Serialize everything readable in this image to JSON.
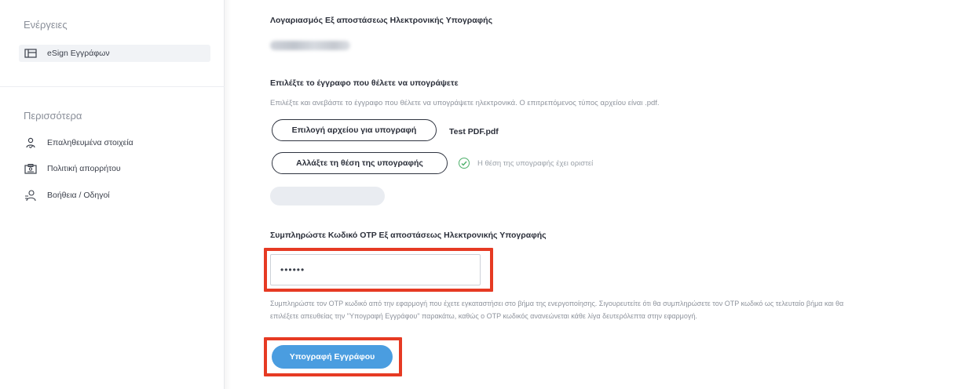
{
  "sidebar": {
    "actions_title": "Ενέργειες",
    "actions_items": [
      {
        "label": "eSign Εγγράφων",
        "icon": "document-grid-icon"
      }
    ],
    "more_title": "Περισσότερα",
    "more_items": [
      {
        "label": "Επαληθευμένα στοιχεία",
        "icon": "verified-user-icon"
      },
      {
        "label": "Πολιτική απορρήτου",
        "icon": "id-card-icon"
      },
      {
        "label": "Βοήθεια / Οδηγοί",
        "icon": "help-person-icon"
      }
    ]
  },
  "main": {
    "account_label": "Λογαριασμός Εξ αποστάσεως Ηλεκτρονικής Υπογραφής",
    "select_title": "Επιλέξτε το έγγραφο που θέλετε να υπογράψετε",
    "select_help": "Επιλέξτε και ανεβάστε το έγγραφο που θέλετε να υπογράψετε ηλεκτρονικά. Ο επιτρεπόμενος τύπος αρχείου είναι .pdf.",
    "choose_file_label": "Επιλογή αρχείου για υπογραφή",
    "file_name": "Test PDF.pdf",
    "change_position_label": "Αλλάξτε τη θέση της υπογραφής",
    "position_status": "Η θέση της υπογραφής έχει οριστεί",
    "otp_title": "Συμπληρώστε Κωδικό OTP Εξ αποστάσεως Ηλεκτρονικής Υπογραφής",
    "otp_value": "••••••",
    "otp_help_1": "Συμπληρώστε τον OTP κωδικό από την εφαρμογή που έχετε εγκαταστήσει στο βήμα της ενεργοποίησης. Σιγουρευτείτε ότι θα συμπληρώσετε τον OTP κωδικό ως τελευταίο βήμα και θα",
    "otp_help_2": "επιλέξετε απευθείας την \"Υπογραφή Εγγράφου\" παρακάτω, καθώς ο OTP κωδικός ανανεώνεται κάθε λίγα δευτερόλεπτα στην εφαρμογή.",
    "sign_button_label": "Υπογραφή Εγγράφου"
  },
  "colors": {
    "highlight": "#e63a23",
    "primary_button": "#4a9de0",
    "success": "#4caf6a"
  }
}
